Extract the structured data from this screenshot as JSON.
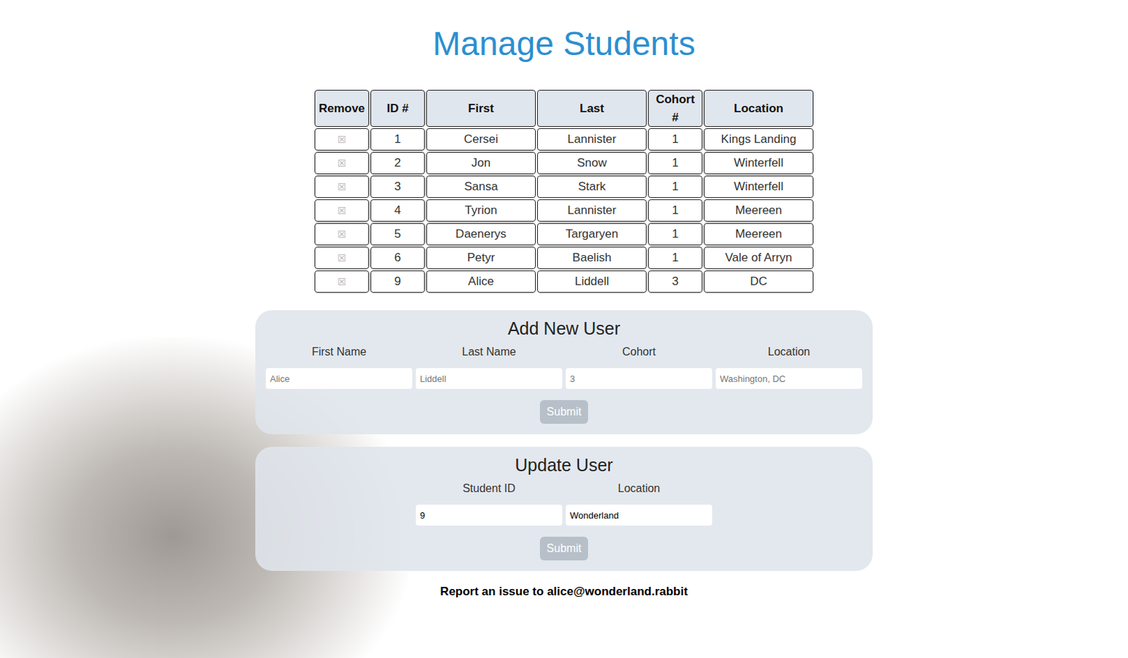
{
  "title": "Manage Students",
  "table": {
    "columns": [
      "Remove",
      "ID #",
      "First",
      "Last",
      "Cohort #",
      "Location"
    ],
    "rows": [
      {
        "remove": "☒",
        "cells": [
          "1",
          "Cersei",
          "Lannister",
          "1",
          "Kings Landing"
        ]
      },
      {
        "remove": "☒",
        "cells": [
          "2",
          "Jon",
          "Snow",
          "1",
          "Winterfell"
        ]
      },
      {
        "remove": "☒",
        "cells": [
          "3",
          "Sansa",
          "Stark",
          "1",
          "Winterfell"
        ]
      },
      {
        "remove": "☒",
        "cells": [
          "4",
          "Tyrion",
          "Lannister",
          "1",
          "Meereen"
        ]
      },
      {
        "remove": "☒",
        "cells": [
          "5",
          "Daenerys",
          "Targaryen",
          "1",
          "Meereen"
        ]
      },
      {
        "remove": "☒",
        "cells": [
          "6",
          "Petyr",
          "Baelish",
          "1",
          "Vale of Arryn"
        ]
      },
      {
        "remove": "☒",
        "cells": [
          "9",
          "Alice",
          "Liddell",
          "3",
          "DC"
        ]
      }
    ]
  },
  "add_form": {
    "title": "Add New User",
    "fields": [
      {
        "label": "First Name",
        "placeholder": "Alice"
      },
      {
        "label": "Last Name",
        "placeholder": "Liddell"
      },
      {
        "label": "Cohort",
        "placeholder": "3"
      },
      {
        "label": "Location",
        "placeholder": "Washington, DC"
      }
    ],
    "button": "Submit"
  },
  "update_form": {
    "title": "Update User",
    "fields": [
      {
        "label": "Student ID",
        "value": "9"
      },
      {
        "label": "Location",
        "value": "Wonderland"
      }
    ],
    "button": "Submit"
  },
  "footer": "Report an issue to alice@wonderland.rabbit"
}
